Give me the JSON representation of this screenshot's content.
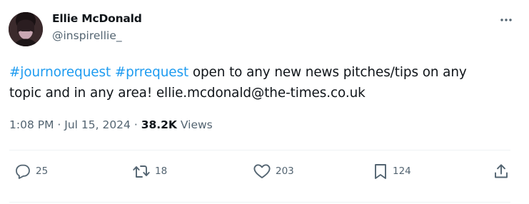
{
  "author": {
    "name": "Ellie McDonald",
    "handle": "@inspirellie_"
  },
  "tweet": {
    "hashtags": [
      "#journorequest",
      "#prrequest"
    ],
    "body_line1_rest": " open to any new news pitches/tips on any",
    "body_line2": "topic and in any area! ellie.mcdonald@the-times.co.uk"
  },
  "meta": {
    "time": "1:08 PM",
    "separator": " · ",
    "date": "Jul 15, 2024",
    "views_count": "38.2K",
    "views_label": " Views"
  },
  "actions": {
    "replies": "25",
    "retweets": "18",
    "likes": "203",
    "bookmarks": "124"
  },
  "colors": {
    "accent": "#1d9bf0",
    "text": "#0f1419",
    "secondary": "#536471"
  },
  "icons": {
    "more": "more-horizontal-icon",
    "reply": "reply-icon",
    "retweet": "retweet-icon",
    "like": "heart-icon",
    "bookmark": "bookmark-icon",
    "share": "share-icon"
  }
}
